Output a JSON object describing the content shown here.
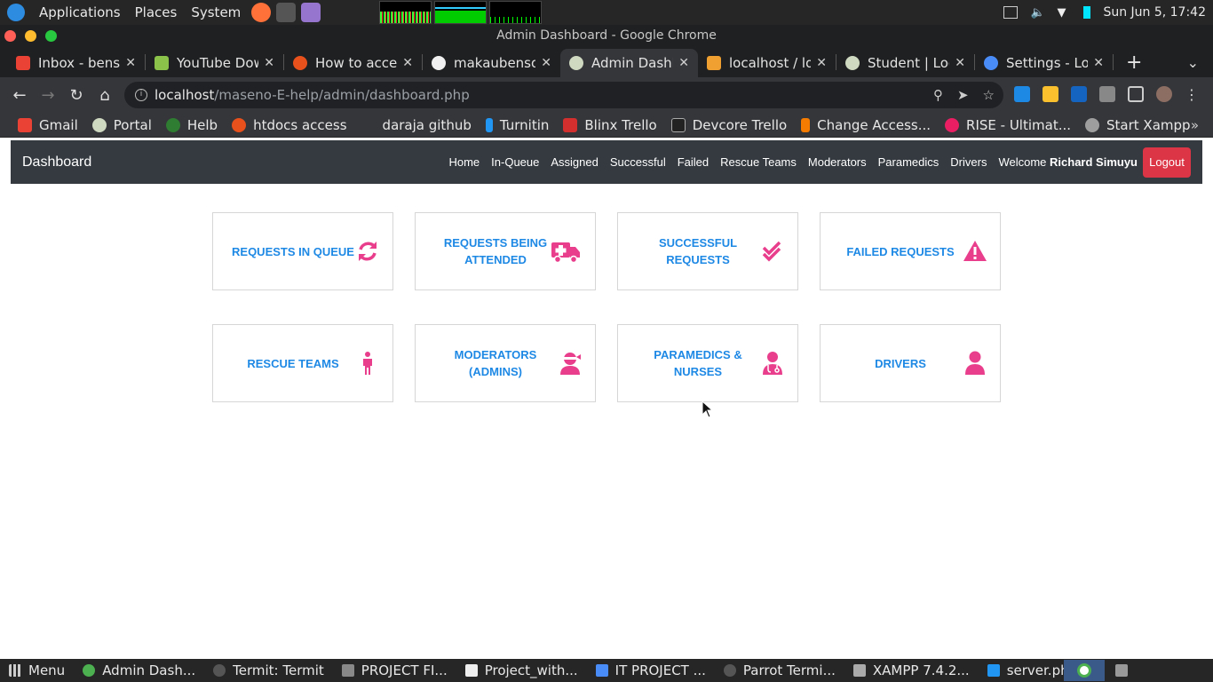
{
  "system_panel": {
    "menus": [
      "Applications",
      "Places",
      "System"
    ],
    "clock": "Sun Jun  5, 17:42"
  },
  "window": {
    "title": "Admin Dashboard - Google Chrome"
  },
  "tabs": [
    {
      "label": "Inbox - benso",
      "color": "#ea4335"
    },
    {
      "label": "YouTube Dow",
      "color": "#8bc34a"
    },
    {
      "label": "How to acces",
      "color": "#e8501c"
    },
    {
      "label": "makaubenson",
      "color": "#f0f0f0"
    },
    {
      "label": "Admin Dashb",
      "color": "#cfd8c0"
    },
    {
      "label": "localhost / loc",
      "color": "#f0a030"
    },
    {
      "label": "Student | Log",
      "color": "#cfd8c0"
    },
    {
      "label": "Settings - Loc",
      "color": "#4a8cf7"
    }
  ],
  "address": {
    "host": "localhost",
    "path": "/maseno-E-help/admin/dashboard.php"
  },
  "bookmarks": [
    {
      "label": "Gmail",
      "color": "#ea4335"
    },
    {
      "label": "Portal",
      "color": "#cfd8c0"
    },
    {
      "label": "Helb",
      "color": "#2e7d32"
    },
    {
      "label": "htdocs access",
      "color": "#e8501c"
    },
    {
      "label": "daraja github",
      "color": "#35363a"
    },
    {
      "label": "Turnitin",
      "color": "#2196f3"
    },
    {
      "label": "Blinx Trello",
      "color": "#d32f2f"
    },
    {
      "label": "Devcore Trello",
      "color": "#222222"
    },
    {
      "label": "Change Access...",
      "color": "#f57c00"
    },
    {
      "label": "RISE - Ultimat...",
      "color": "#e91e63"
    },
    {
      "label": "Start Xampp",
      "color": "#9e9e9e"
    }
  ],
  "navbar": {
    "brand": "Dashboard",
    "links": [
      "Home",
      "In-Queue",
      "Assigned",
      "Successful",
      "Failed",
      "Rescue Teams",
      "Moderators",
      "Paramedics",
      "Drivers"
    ],
    "welcome_prefix": "Welcome",
    "user": "Richard Simuyu",
    "logout": "Logout"
  },
  "cards": [
    {
      "line1": "REQUESTS IN QUEUE",
      "line2": "",
      "icon": "refresh-icon"
    },
    {
      "line1": "REQUESTS BEING",
      "line2": "ATTENDED",
      "icon": "ambulance-icon"
    },
    {
      "line1": "SUCCESSFUL",
      "line2": "REQUESTS",
      "icon": "double-check-icon"
    },
    {
      "line1": "FAILED REQUESTS",
      "line2": "",
      "icon": "warning-icon"
    },
    {
      "line1": "RESCUE TEAMS",
      "line2": "",
      "icon": "person-standing-icon"
    },
    {
      "line1": "MODERATORS",
      "line2": "(ADMINS)",
      "icon": "user-ninja-icon"
    },
    {
      "line1": "PARAMEDICS &",
      "line2": "NURSES",
      "icon": "doctor-icon"
    },
    {
      "line1": "DRIVERS",
      "line2": "",
      "icon": "user-icon"
    }
  ],
  "accent": "#1e88e5",
  "icon_color": "#e83e8c",
  "taskbar": [
    {
      "label": "Menu",
      "color": "#cccccc"
    },
    {
      "label": "Admin Dash...",
      "color": "#4caf50"
    },
    {
      "label": "Termit: Termit",
      "color": "#555555"
    },
    {
      "label": "PROJECT FI...",
      "color": "#888888"
    },
    {
      "label": "Project_with...",
      "color": "#eeeeee"
    },
    {
      "label": "IT PROJECT ...",
      "color": "#4a8cf7"
    },
    {
      "label": "Parrot Termi...",
      "color": "#555555"
    },
    {
      "label": "XAMPP 7.4.2...",
      "color": "#aaaaaa"
    },
    {
      "label": "server.php - ...",
      "color": "#2196f3"
    }
  ]
}
